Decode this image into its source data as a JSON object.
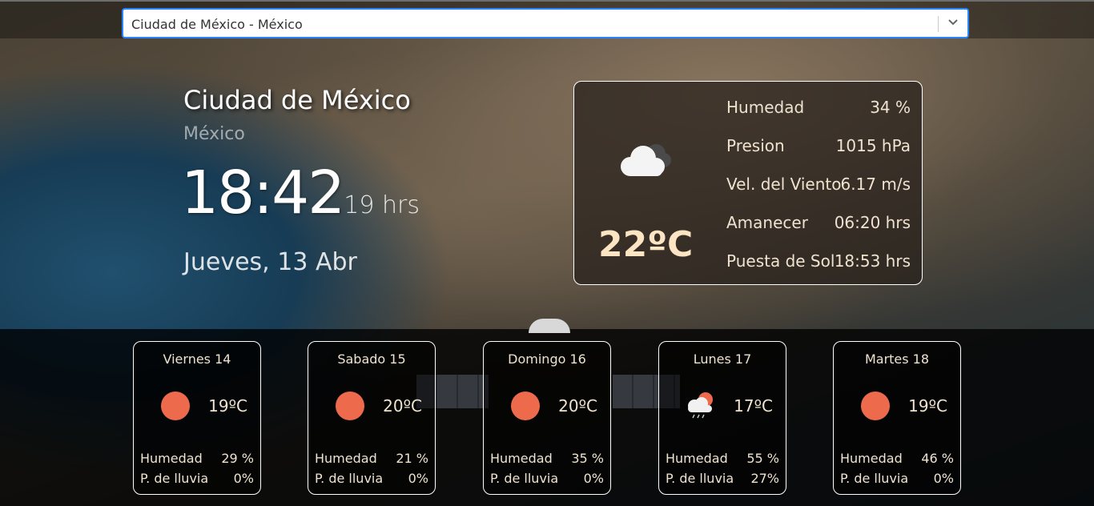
{
  "select": {
    "value": "Ciudad de México - México"
  },
  "location": {
    "city": "Ciudad de México",
    "country": "México"
  },
  "clock": {
    "time": "18:42",
    "suffix": "19 hrs",
    "date": "Jueves, 13 Abr"
  },
  "current": {
    "temp": "22ºC",
    "icon": "cloud-icon",
    "metrics": [
      {
        "label": "Humedad",
        "value": "34 %"
      },
      {
        "label": "Presion",
        "value": "1015 hPa"
      },
      {
        "label": "Vel. del Viento",
        "value": "6.17 m/s"
      },
      {
        "label": "Amanecer",
        "value": "06:20 hrs"
      },
      {
        "label": "Puesta de Sol",
        "value": "18:53 hrs"
      }
    ]
  },
  "forecast": [
    {
      "day": "Viernes 14",
      "temp": "19ºC",
      "icon": "sun-icon",
      "humidity_label": "Humedad",
      "humidity": "29 %",
      "rain_label": "P. de lluvia",
      "rain": "0%"
    },
    {
      "day": "Sabado 15",
      "temp": "20ºC",
      "icon": "sun-icon",
      "humidity_label": "Humedad",
      "humidity": "21 %",
      "rain_label": "P. de lluvia",
      "rain": "0%"
    },
    {
      "day": "Domingo 16",
      "temp": "20ºC",
      "icon": "sun-icon",
      "humidity_label": "Humedad",
      "humidity": "35 %",
      "rain_label": "P. de lluvia",
      "rain": "0%"
    },
    {
      "day": "Lunes 17",
      "temp": "17ºC",
      "icon": "sun-rain-cloud-icon",
      "humidity_label": "Humedad",
      "humidity": "55 %",
      "rain_label": "P. de lluvia",
      "rain": "27%"
    },
    {
      "day": "Martes 18",
      "temp": "19ºC",
      "icon": "sun-icon",
      "humidity_label": "Humedad",
      "humidity": "46 %",
      "rain_label": "P. de lluvia",
      "rain": "0%"
    }
  ],
  "colors": {
    "accent": "#2684ff",
    "sun": "#ee6a4c",
    "temp": "#fde5c3",
    "text": "#efe2cf"
  }
}
